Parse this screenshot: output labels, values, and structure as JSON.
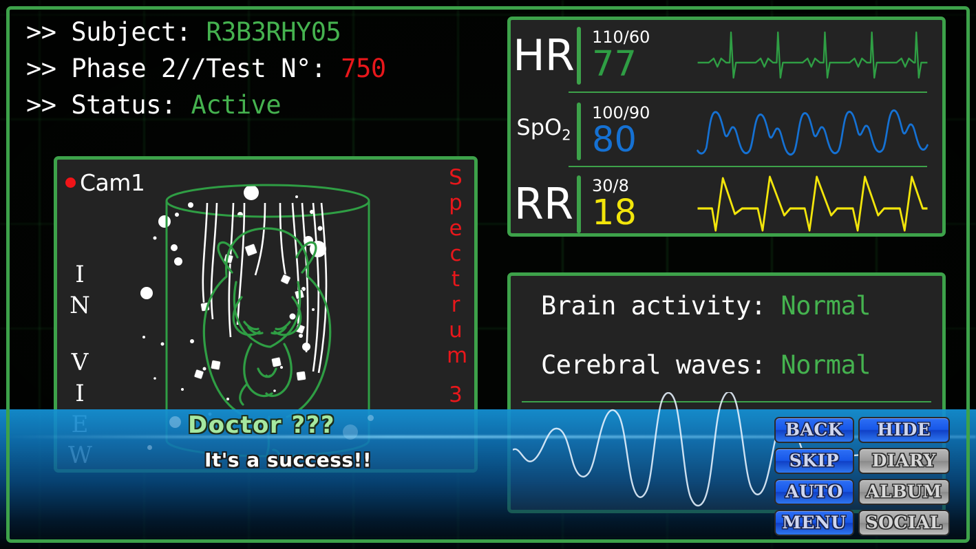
{
  "header": {
    "line1_prefix": ">> Subject: ",
    "line1_value": "R3B3RHY05",
    "line2_prefix": ">> Phase 2//Test N°: ",
    "line2_value": "750",
    "line3_prefix": ">> Status: ",
    "line3_value": "Active"
  },
  "camera": {
    "label": "Cam1",
    "rec_indicator": "rec-dot",
    "side_label_left": [
      "I",
      "N",
      "",
      "V",
      "I",
      "E",
      "W"
    ],
    "side_label_right": [
      "S",
      "p",
      "e",
      "c",
      "t",
      "r",
      "u",
      "m",
      "",
      "3"
    ],
    "side_label_right_text": "Spectrum 3"
  },
  "vitals": [
    {
      "name": "HR",
      "name_style": "big",
      "range": "110/60",
      "value": "77",
      "color": "#2f9e44",
      "wave_type": "ecg"
    },
    {
      "name": "SpO",
      "name_sub": "2",
      "name_style": "small",
      "range": "100/90",
      "value": "80",
      "color": "#1571d3",
      "wave_type": "pleth"
    },
    {
      "name": "RR",
      "name_style": "big",
      "range": "30/8",
      "value": "18",
      "color": "#f2e50b",
      "wave_type": "resp"
    }
  ],
  "brain": {
    "line1_label": "Brain activity: ",
    "line1_value": "Normal",
    "line2_label": "Cerebral waves: ",
    "line2_value": "Normal",
    "wave_color": "#e8f4ff"
  },
  "dialogue": {
    "speaker": "Doctor ???",
    "text": "It's a success!!",
    "speaker_color": "#a6e8a0",
    "text_color": "#ffffff"
  },
  "buttons": [
    {
      "label": "BACK",
      "style": "blue"
    },
    {
      "label": "HIDE",
      "style": "blue"
    },
    {
      "label": "SKIP",
      "style": "blue"
    },
    {
      "label": "DIARY",
      "style": "gray"
    },
    {
      "label": "AUTO",
      "style": "blue"
    },
    {
      "label": "ALBUM",
      "style": "gray"
    },
    {
      "label": "MENU",
      "style": "blue"
    },
    {
      "label": "SOCIAL",
      "style": "gray"
    }
  ],
  "colors": {
    "frame_green": "#3da24a",
    "panel_bg": "#232323",
    "accent_red": "#e8171b",
    "accent_green": "#45b24f",
    "dialogue_blue": "#1492d6"
  }
}
